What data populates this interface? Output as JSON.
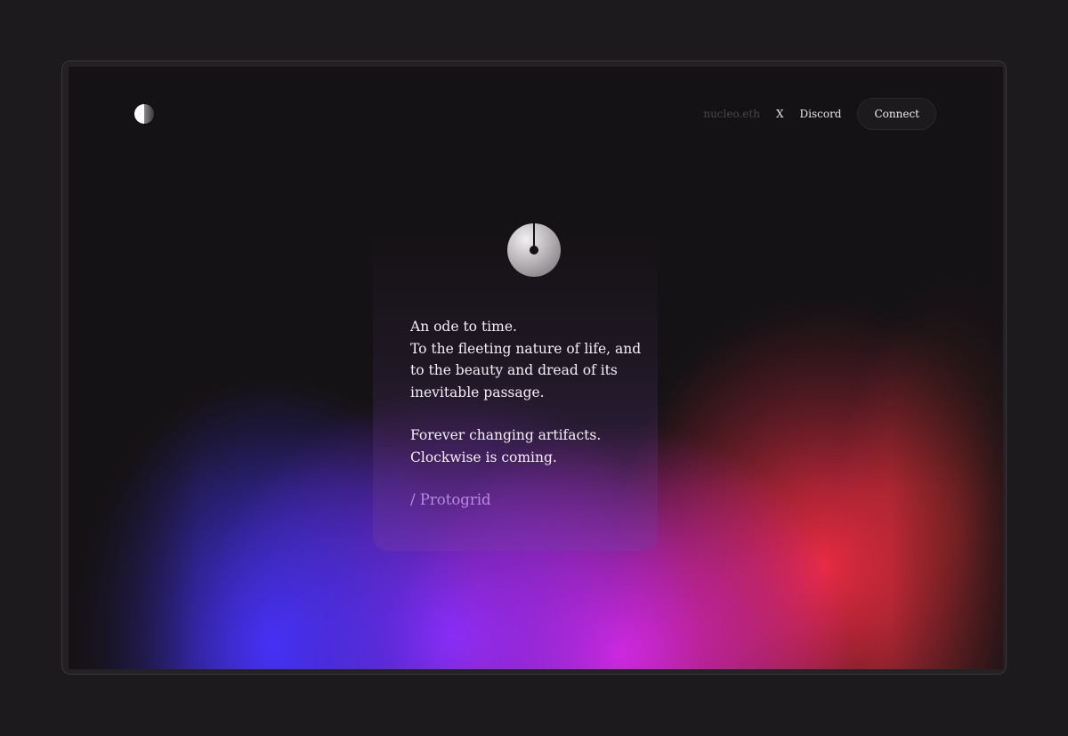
{
  "nav": {
    "items": [
      {
        "label": "nucleo.eth",
        "dim": true
      },
      {
        "label": "X",
        "dim": false
      },
      {
        "label": "Discord",
        "dim": false
      }
    ],
    "connect_label": "Connect"
  },
  "poem": {
    "stanza1": [
      "An ode to time.",
      "To the fleeting nature of life, and",
      "to the beauty and dread of its",
      "inevitable passage."
    ],
    "stanza2": [
      "Forever changing artifacts.",
      "Clockwise is coming."
    ],
    "signature": "/ Protogrid"
  },
  "colors": {
    "background": "#151215",
    "blue": "#4632ff",
    "violet": "#962dff",
    "magenta": "#f028dc",
    "red": "#ff2d46"
  },
  "icons": {
    "logo": "half-circle-logo-icon",
    "clock": "clock-icon"
  }
}
